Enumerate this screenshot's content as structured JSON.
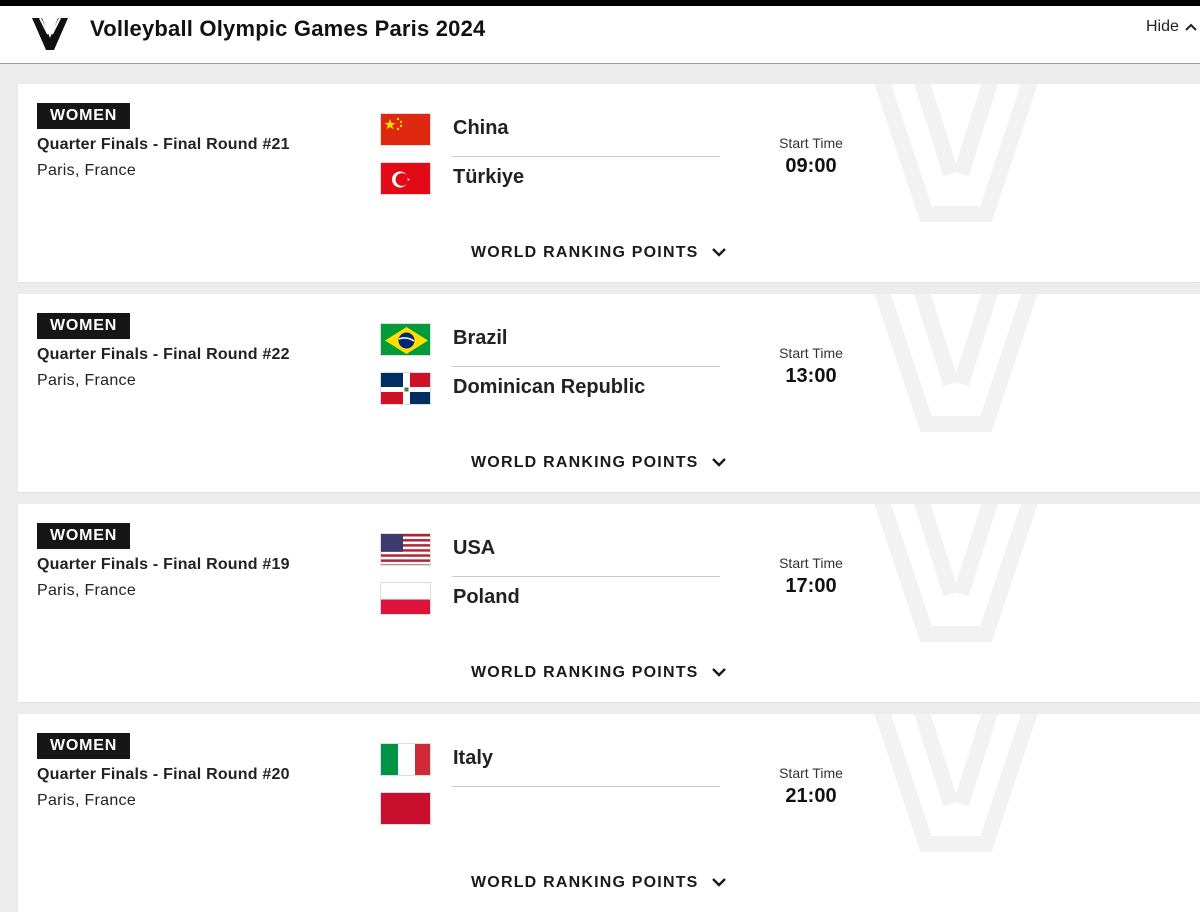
{
  "header": {
    "title": "Volleyball Olympic Games Paris 2024",
    "hide_label": "Hide"
  },
  "matches": [
    {
      "category": "WOMEN",
      "round": "Quarter Finals - Final Round #21",
      "location": "Paris, France",
      "team1": "China",
      "team2": "Türkiye",
      "start_label": "Start Time",
      "start_time": "09:00",
      "ranking_label": "WORLD RANKING POINTS"
    },
    {
      "category": "WOMEN",
      "round": "Quarter Finals - Final Round #22",
      "location": "Paris, France",
      "team1": "Brazil",
      "team2": "Dominican Republic",
      "start_label": "Start Time",
      "start_time": "13:00",
      "ranking_label": "WORLD RANKING POINTS"
    },
    {
      "category": "WOMEN",
      "round": "Quarter Finals - Final Round #19",
      "location": "Paris, France",
      "team1": "USA",
      "team2": "Poland",
      "start_label": "Start Time",
      "start_time": "17:00",
      "ranking_label": "WORLD RANKING POINTS"
    },
    {
      "category": "WOMEN",
      "round": "Quarter Finals - Final Round #20",
      "location": "Paris, France",
      "team1": "Italy",
      "team2": "",
      "start_label": "Start Time",
      "start_time": "21:00",
      "ranking_label": "WORLD RANKING POINTS"
    }
  ],
  "colors": {
    "badge_bg": "#161616",
    "page_bg": "#ececec",
    "china_red": "#de2910",
    "turkey_red": "#e30a17",
    "brazil_green": "#009c3b",
    "brazil_yellow": "#ffdf00",
    "dr_blue": "#002d62",
    "dr_red": "#ce1126",
    "usa_red": "#b22234",
    "usa_blue": "#3c3b6e",
    "poland_red": "#dc143c",
    "italy_green": "#009246",
    "italy_red": "#ce2b37"
  },
  "icons": {
    "logo": "volleyball-world-logo-icon",
    "chevron": "chevron-down-icon"
  }
}
